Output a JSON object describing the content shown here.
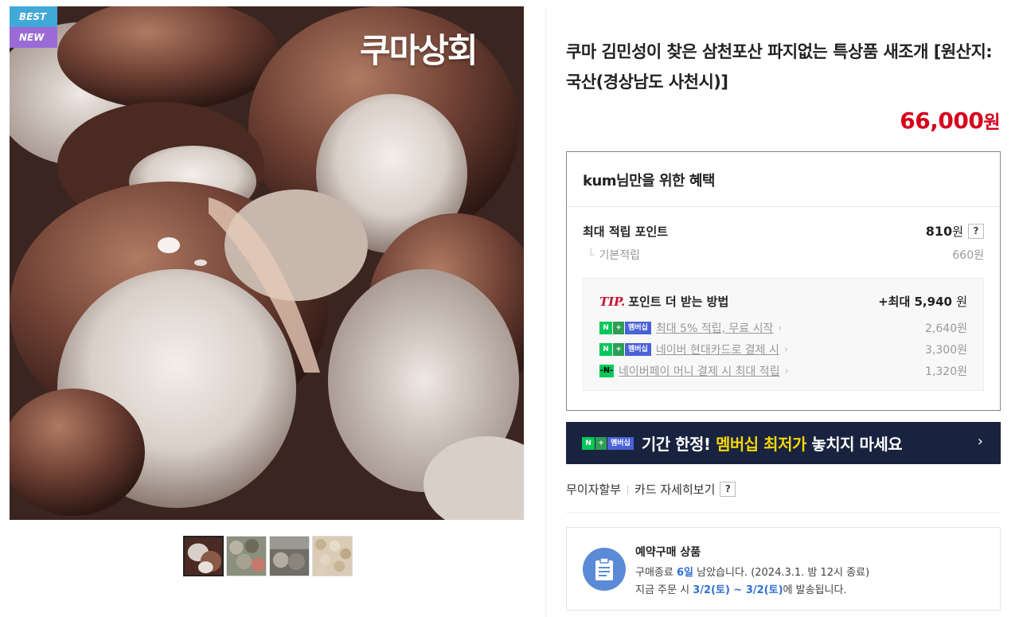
{
  "badges": {
    "best": "BEST",
    "new": "NEW"
  },
  "image": {
    "brand_text": "쿠마상회"
  },
  "thumbnails": [
    "thumb-1",
    "thumb-2",
    "thumb-3",
    "thumb-4"
  ],
  "product": {
    "title": "쿠마 김민성이 찾은 삼천포산 파지없는 특상품 새조개 [원산지:국산(경상남도 사천시)]",
    "price": "66,000",
    "price_unit": "원"
  },
  "benefit": {
    "heading": "kum님만을 위한 혜택",
    "max_point_label": "최대 적립 포인트",
    "max_point_value": "810",
    "unit": "원",
    "help": "?",
    "base_label": "기본적립",
    "base_value": "660원",
    "tip": {
      "tip_label": "TIP.",
      "title": "포인트 더 받는 방법",
      "max_prefix": "+최대",
      "max_value": "5,940",
      "max_unit": "원",
      "items": [
        {
          "badge": "membership",
          "text": "최대 5% 적립, 무료 시작",
          "value": "2,640원"
        },
        {
          "badge": "membership",
          "text": "네이버 현대카드로 결제 시",
          "value": "3,300원"
        },
        {
          "badge": "npay",
          "text": "네이버페이 머니 결제 시 최대 적립",
          "value": "1,320원"
        }
      ]
    }
  },
  "membership_badge": {
    "n": "N",
    "plus": "+",
    "label": "멤버십"
  },
  "promo": {
    "pre": "기간 한정! ",
    "highlight": "멤버십 최저가",
    "post": " 놓치지 마세요",
    "arrow": "›"
  },
  "installment": {
    "free": "무이자할부",
    "card": "카드 자세히보기",
    "help": "?"
  },
  "reserve": {
    "heading": "예약구매 상품",
    "line1_pre": "구매종료 ",
    "line1_days": "6일",
    "line1_post": " 남았습니다. (2024.3.1. 밤 12시 종료)",
    "line2_pre": "지금 주문 시 ",
    "line2_date": "3/2(토) ~ 3/2(토)",
    "line2_post": "에 발송됩니다."
  },
  "colors": {
    "price": "#d6001c",
    "promo_bg": "#19233f",
    "promo_highlight": "#f5d60a",
    "naver_green": "#03c75a",
    "membership_blue": "#4a62d8"
  }
}
